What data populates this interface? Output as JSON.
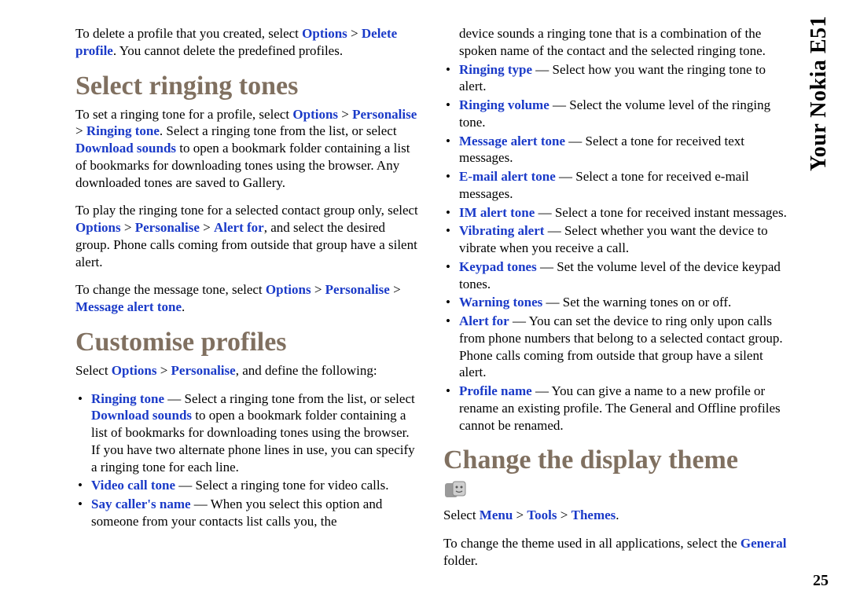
{
  "sidebar_title": "Your Nokia E51",
  "page_number": "25",
  "col1": {
    "p1_a": "To delete a profile that you created, select ",
    "p1_opt": "Options",
    "p1_gt": " > ",
    "p1_del": "Delete profile",
    "p1_b": ". You cannot delete the predefined profiles.",
    "h1": "Select ringing tones",
    "p2_a": "To set a ringing tone for a profile, select ",
    "p2_opt": "Options",
    "p2_gt": " > ",
    "p2_per": "Personalise",
    "p2_gt2": " > ",
    "p2_rt": "Ringing tone",
    "p2_b": ". Select a ringing tone from the list, or select ",
    "p2_dl": "Download sounds",
    "p2_c": " to open a bookmark folder containing a list of bookmarks for downloading tones using the browser. Any downloaded tones are saved to Gallery.",
    "p3_a": "To play the ringing tone for a selected contact group only, select ",
    "p3_opt": "Options",
    "p3_gt": " > ",
    "p3_per": "Personalise",
    "p3_gt2": " > ",
    "p3_af": "Alert for",
    "p3_b": ", and select the desired group. Phone calls coming from outside that group have a silent alert.",
    "p4_a": "To change the message tone, select ",
    "p4_opt": "Options",
    "p4_gt": " > ",
    "p4_per": "Personalise",
    "p4_gt2": " > ",
    "p4_mat": "Message alert tone",
    "p4_b": ".",
    "h2": "Customise profiles",
    "p5_a": "Select ",
    "p5_opt": "Options",
    "p5_gt": " > ",
    "p5_per": "Personalise",
    "p5_b": ", and define the following:",
    "li1_t": "Ringing tone",
    "li1_a": " — Select a ringing tone from the list, or select ",
    "li1_dl": "Download sounds",
    "li1_b": " to open a bookmark folder containing a list of bookmarks for downloading tones using the browser. If you have two alternate phone lines in use, you can specify a ringing tone for each line.",
    "li2_t": "Video call tone",
    "li2_a": " — Select a ringing tone for video calls.",
    "li3_t": "Say caller's name",
    "li3_a": " — When you select this option and someone from your contacts list calls you, the"
  },
  "col2": {
    "p0": "device sounds a ringing tone that is a combination of the spoken name of the contact and the selected ringing tone.",
    "li1_t": "Ringing type",
    "li1_a": " — Select how you want the ringing tone to alert.",
    "li2_t": "Ringing volume",
    "li2_a": " — Select the volume level of the ringing tone.",
    "li3_t": "Message alert tone",
    "li3_a": " — Select a tone for received text messages.",
    "li4_t": "E-mail alert tone",
    "li4_a": " — Select a tone for received e-mail messages.",
    "li5_t": "IM alert tone",
    "li5_a": " — Select a tone for received instant messages.",
    "li6_t": "Vibrating alert",
    "li6_a": " — Select whether you want the device to vibrate when you receive a call.",
    "li7_t": "Keypad tones",
    "li7_a": " — Set the volume level of the device keypad tones.",
    "li8_t": "Warning tones",
    "li8_a": " — Set the warning tones on or off.",
    "li9_t": "Alert for",
    "li9_a": " — You can set the device to ring only upon calls from phone numbers that belong to a selected contact group. Phone calls coming from outside that group have a silent alert.",
    "li10_t": "Profile name",
    "li10_a": " — You can give a name to a new profile or rename an existing profile. The General and Offline profiles cannot be renamed.",
    "h1": "Change the display theme",
    "p1_a": "Select ",
    "p1_menu": "Menu",
    "p1_gt": " > ",
    "p1_tools": "Tools",
    "p1_gt2": " > ",
    "p1_themes": "Themes",
    "p1_dot": ".",
    "p2_a": "To change the theme used in all applications, select the ",
    "p2_gen": "General",
    "p2_b": " folder."
  }
}
